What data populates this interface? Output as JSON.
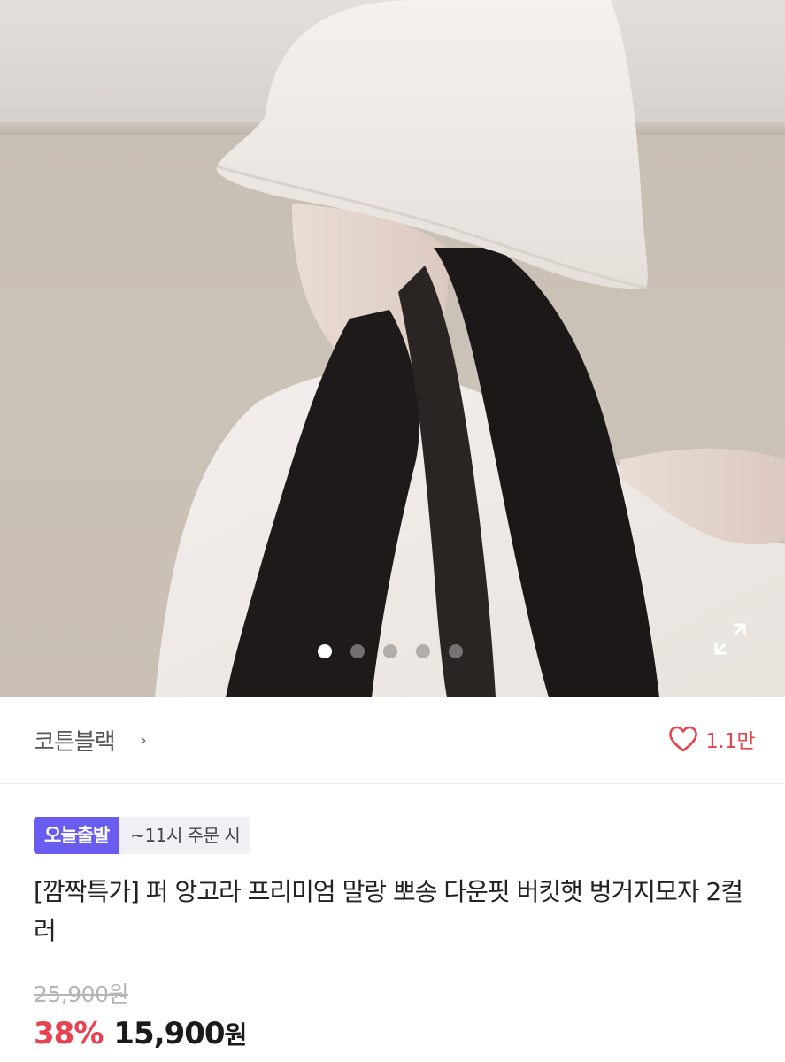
{
  "gallery": {
    "image_alt": "product photo",
    "dot_count": 5,
    "active_index": 0
  },
  "store": {
    "name": "코튼블랙",
    "chevron": "›",
    "like_count": "1.1만",
    "like_icon": "heart-icon"
  },
  "badges": {
    "today_shipping": "오늘출발",
    "order_deadline": "~11시 주문 시"
  },
  "product": {
    "title": "[깜짝특가] 퍼 앙고라 프리미엄 말랑 뽀송 다운핏 버킷햇 벙거지모자 2컬러",
    "original_price": "25,900원",
    "discount": "38%",
    "price": "15,900",
    "price_unit": "원"
  },
  "colors": {
    "accent_red": "#e8414f",
    "badge_purple": "#6b5cf0"
  }
}
